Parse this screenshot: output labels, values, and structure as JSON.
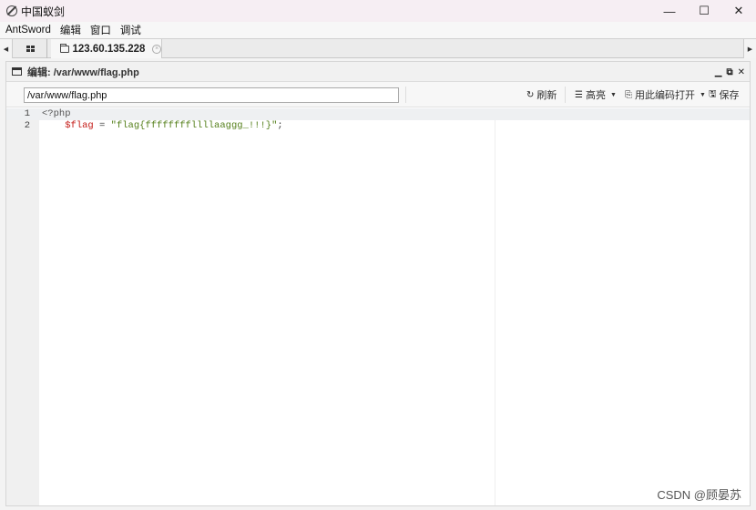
{
  "window": {
    "title": "中国蚁剑",
    "controls": {
      "minimize": "—",
      "maximize": "☐",
      "close": "✕"
    }
  },
  "menu": [
    "AntSword",
    "编辑",
    "窗口",
    "调试"
  ],
  "tabs": {
    "left_arrow": "◀",
    "right_arrow": "▶",
    "active": {
      "label": "123.60.135.228",
      "close": "×"
    }
  },
  "panel": {
    "title": "编辑: /var/www/flag.php",
    "controls": [
      "▁",
      "⧉",
      "✕"
    ]
  },
  "toolbar": {
    "path_value": "/var/www/flag.php",
    "refresh_icon": "↻",
    "refresh_label": "刷新",
    "highlight_icon": "☰",
    "highlight_label": "高亮",
    "encoding_icon": "⎘",
    "encoding_label": "用此编码打开",
    "save_icon": "🖫",
    "save_label": "保存",
    "caret": "▼"
  },
  "editor": {
    "lines": [
      {
        "num": "1",
        "tag": "<?php"
      },
      {
        "num": "2",
        "indent": "    ",
        "var": "$flag",
        "op": " = ",
        "str": "\"flag{ffffffffllllaaggg_!!!}\"",
        "end": ";"
      }
    ]
  },
  "watermark": "CSDN @顾晏苏"
}
